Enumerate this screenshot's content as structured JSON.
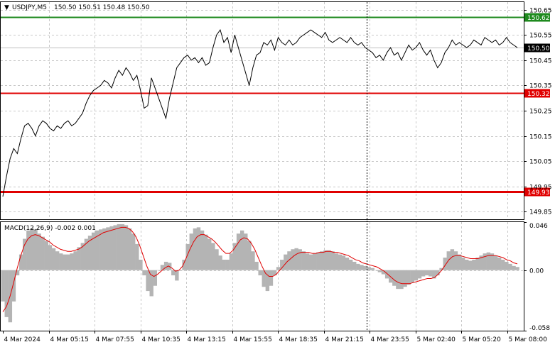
{
  "header": {
    "menu_glyph": "▼",
    "symbol": "USDJPY,M5",
    "ohlc": "150.50 150.51 150.48 150.50"
  },
  "price_panel": {
    "y_ticks": [
      "150.65",
      "150.55",
      "150.45",
      "150.35",
      "150.25",
      "150.15",
      "150.05",
      "149.95",
      "149.85"
    ],
    "levels": [
      {
        "name": "green-level",
        "value": 150.62,
        "label": "150.62",
        "color": "#1e8a1e"
      },
      {
        "name": "red-level-upper",
        "value": 150.32,
        "label": "150.32",
        "color": "#e00000"
      },
      {
        "name": "red-level-lower",
        "value": 149.93,
        "label": "149.93",
        "color": "#e00000"
      }
    ],
    "current_price": {
      "value": 150.5,
      "label": "150.50",
      "color": "#000000"
    }
  },
  "macd_panel": {
    "title": "MACD(12,26,9) -0.002 0.001",
    "y_ticks": [
      "0.046",
      "0.00",
      "-0.058"
    ]
  },
  "x_ticks": [
    "4 Mar 2024",
    "4 Mar 05:15",
    "4 Mar 07:55",
    "4 Mar 10:35",
    "4 Mar 13:15",
    "4 Mar 15:55",
    "4 Mar 18:35",
    "4 Mar 21:15",
    "4 Mar 23:55",
    "5 Mar 02:40",
    "5 Mar 05:20",
    "5 Mar 08:00"
  ],
  "chart_data": [
    {
      "type": "line",
      "title": "USDJPY,M5",
      "ylim": [
        149.82,
        150.68
      ],
      "grid": true,
      "series": [
        {
          "name": "USDJPY,M5",
          "values": [
            149.91,
            149.99,
            150.06,
            150.1,
            150.08,
            150.14,
            150.19,
            150.2,
            150.18,
            150.15,
            150.19,
            150.21,
            150.2,
            150.18,
            150.17,
            150.19,
            150.18,
            150.2,
            150.21,
            150.19,
            150.2,
            150.22,
            150.24,
            150.28,
            150.31,
            150.33,
            150.34,
            150.35,
            150.37,
            150.36,
            150.34,
            150.38,
            150.41,
            150.39,
            150.42,
            150.4,
            150.37,
            150.39,
            150.33,
            150.26,
            150.27,
            150.38,
            150.34,
            150.3,
            150.26,
            150.22,
            150.3,
            150.36,
            150.42,
            150.44,
            150.46,
            150.47,
            150.45,
            150.46,
            150.44,
            150.46,
            150.43,
            150.44,
            150.5,
            150.55,
            150.57,
            150.52,
            150.54,
            150.48,
            150.55,
            150.5,
            150.45,
            150.4,
            150.35,
            150.42,
            150.47,
            150.48,
            150.52,
            150.51,
            150.53,
            150.49,
            150.54,
            150.52,
            150.51,
            150.53,
            150.51,
            150.52,
            150.54,
            150.55,
            150.56,
            150.57,
            150.56,
            150.55,
            150.54,
            150.56,
            150.53,
            150.52,
            150.53,
            150.54,
            150.53,
            150.52,
            150.54,
            150.52,
            150.51,
            150.52,
            150.5,
            150.49,
            150.48,
            150.46,
            150.47,
            150.45,
            150.48,
            150.5,
            150.47,
            150.48,
            150.45,
            150.48,
            150.51,
            150.49,
            150.5,
            150.52,
            150.49,
            150.47,
            150.49,
            150.45,
            150.42,
            150.44,
            150.48,
            150.5,
            150.53,
            150.51,
            150.52,
            150.51,
            150.5,
            150.51,
            150.53,
            150.52,
            150.51,
            150.54,
            150.53,
            150.52,
            150.53,
            150.51,
            150.52,
            150.54,
            150.52,
            150.51,
            150.5
          ]
        }
      ]
    },
    {
      "type": "bar",
      "title": "MACD(12,26,9) -0.002 0.001",
      "ylim": [
        -0.058,
        0.046
      ],
      "series": [
        {
          "name": "MACD",
          "values": [
            -0.03,
            -0.045,
            -0.05,
            -0.03,
            -0.005,
            0.015,
            0.03,
            0.038,
            0.04,
            0.039,
            0.035,
            0.032,
            0.028,
            0.024,
            0.021,
            0.018,
            0.016,
            0.015,
            0.015,
            0.016,
            0.018,
            0.022,
            0.026,
            0.03,
            0.033,
            0.036,
            0.038,
            0.039,
            0.04,
            0.041,
            0.042,
            0.043,
            0.044,
            0.044,
            0.043,
            0.04,
            0.035,
            0.025,
            0.01,
            -0.005,
            -0.02,
            -0.025,
            -0.015,
            0.0,
            0.005,
            0.008,
            0.007,
            -0.005,
            -0.01,
            0.0,
            0.01,
            0.025,
            0.035,
            0.04,
            0.041,
            0.038,
            0.034,
            0.03,
            0.026,
            0.02,
            0.014,
            0.01,
            0.01,
            0.016,
            0.026,
            0.035,
            0.038,
            0.035,
            0.028,
            0.018,
            0.008,
            -0.005,
            -0.016,
            -0.02,
            -0.015,
            -0.005,
            0.003,
            0.01,
            0.015,
            0.018,
            0.02,
            0.021,
            0.02,
            0.018,
            0.016,
            0.015,
            0.016,
            0.017,
            0.018,
            0.019,
            0.019,
            0.018,
            0.016,
            0.015,
            0.014,
            0.012,
            0.01,
            0.008,
            0.006,
            0.005,
            0.004,
            0.003,
            0.002,
            0.0,
            -0.002,
            -0.004,
            -0.008,
            -0.012,
            -0.015,
            -0.018,
            -0.018,
            -0.016,
            -0.014,
            -0.012,
            -0.01,
            -0.008,
            -0.006,
            -0.005,
            -0.006,
            -0.008,
            -0.005,
            0.002,
            0.012,
            0.018,
            0.02,
            0.018,
            0.015,
            0.012,
            0.01,
            0.009,
            0.01,
            0.012,
            0.014,
            0.016,
            0.017,
            0.016,
            0.014,
            0.012,
            0.01,
            0.008,
            0.006,
            0.004,
            0.003
          ]
        },
        {
          "name": "Signal",
          "values": [
            -0.04,
            -0.035,
            -0.025,
            -0.012,
            0.002,
            0.014,
            0.024,
            0.03,
            0.033,
            0.034,
            0.033,
            0.031,
            0.029,
            0.027,
            0.024,
            0.022,
            0.02,
            0.019,
            0.018,
            0.018,
            0.019,
            0.02,
            0.022,
            0.025,
            0.028,
            0.03,
            0.032,
            0.034,
            0.036,
            0.037,
            0.038,
            0.039,
            0.04,
            0.041,
            0.041,
            0.04,
            0.037,
            0.032,
            0.024,
            0.014,
            0.004,
            -0.004,
            -0.006,
            -0.004,
            -0.001,
            0.002,
            0.004,
            0.002,
            -0.001,
            0.0,
            0.004,
            0.012,
            0.02,
            0.027,
            0.032,
            0.034,
            0.034,
            0.032,
            0.03,
            0.027,
            0.023,
            0.019,
            0.016,
            0.016,
            0.019,
            0.024,
            0.029,
            0.031,
            0.03,
            0.026,
            0.02,
            0.012,
            0.004,
            -0.003,
            -0.006,
            -0.006,
            -0.004,
            0.0,
            0.004,
            0.008,
            0.011,
            0.014,
            0.016,
            0.017,
            0.017,
            0.017,
            0.016,
            0.016,
            0.017,
            0.017,
            0.018,
            0.018,
            0.017,
            0.017,
            0.016,
            0.015,
            0.014,
            0.012,
            0.01,
            0.009,
            0.007,
            0.006,
            0.005,
            0.004,
            0.003,
            0.001,
            -0.001,
            -0.004,
            -0.007,
            -0.01,
            -0.012,
            -0.013,
            -0.013,
            -0.013,
            -0.012,
            -0.011,
            -0.01,
            -0.009,
            -0.008,
            -0.008,
            -0.007,
            -0.004,
            0.0,
            0.005,
            0.01,
            0.013,
            0.014,
            0.014,
            0.013,
            0.012,
            0.011,
            0.011,
            0.011,
            0.012,
            0.013,
            0.014,
            0.014,
            0.014,
            0.013,
            0.012,
            0.01,
            0.009,
            0.007,
            0.006
          ]
        }
      ]
    }
  ],
  "colors": {
    "price_line": "#000000",
    "macd_hist": "#b4b4b4",
    "signal_line": "#e00000",
    "grid": "#c8c8c8",
    "vline": "#000000"
  }
}
